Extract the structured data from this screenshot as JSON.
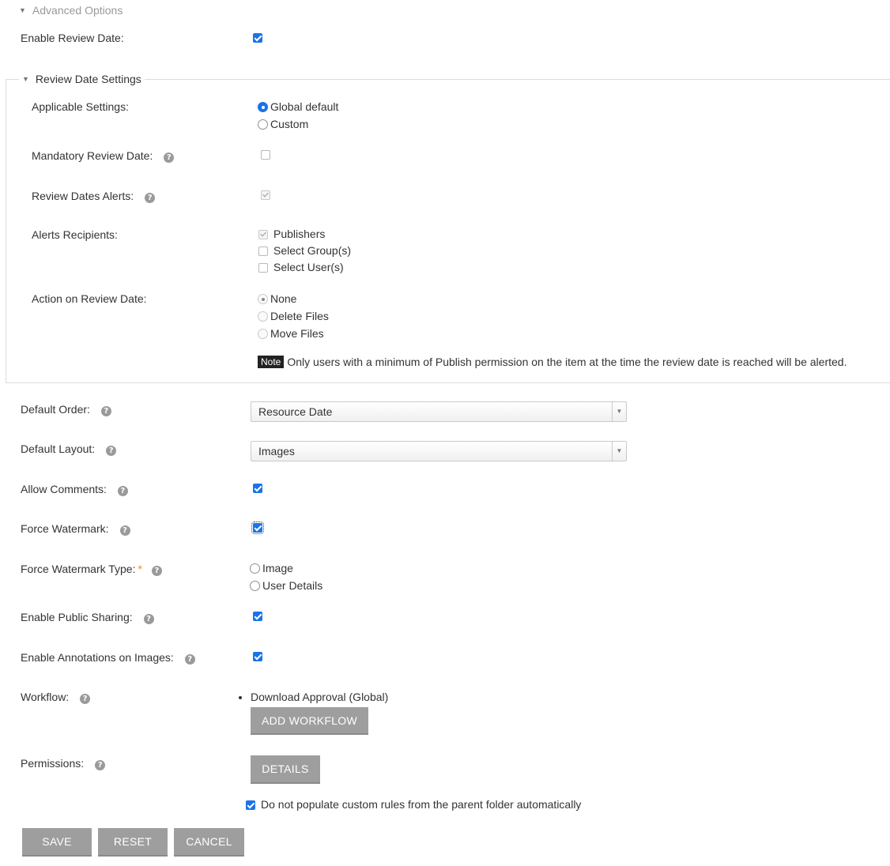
{
  "advanced_options": {
    "label": "Advanced Options"
  },
  "enable_review_date": {
    "label": "Enable Review Date:"
  },
  "review_date_settings": {
    "legend": "Review Date Settings",
    "applicable_settings": {
      "label": "Applicable Settings:",
      "options": [
        "Global default",
        "Custom"
      ],
      "selected": "Global default"
    },
    "mandatory_review_date": {
      "label": "Mandatory Review Date:"
    },
    "review_dates_alerts": {
      "label": "Review Dates Alerts:"
    },
    "alerts_recipients": {
      "label": "Alerts Recipients:",
      "options": [
        "Publishers",
        "Select Group(s)",
        "Select User(s)"
      ]
    },
    "action_on_review_date": {
      "label": "Action on Review Date:",
      "options": [
        "None",
        "Delete Files",
        "Move Files"
      ],
      "selected": "None"
    },
    "note": {
      "badge": "Note",
      "text": "Only users with a minimum of Publish permission on the item at the time the review date is reached will be alerted."
    }
  },
  "default_order": {
    "label": "Default Order:",
    "value": "Resource Date"
  },
  "default_layout": {
    "label": "Default Layout:",
    "value": "Images"
  },
  "allow_comments": {
    "label": "Allow Comments:"
  },
  "force_watermark": {
    "label": "Force Watermark:"
  },
  "force_watermark_type": {
    "label": "Force Watermark Type:",
    "required_mark": "*",
    "options": [
      "Image",
      "User Details"
    ]
  },
  "enable_public_sharing": {
    "label": "Enable Public Sharing:"
  },
  "enable_annotations": {
    "label": "Enable Annotations on Images:"
  },
  "workflow": {
    "label": "Workflow:",
    "items": [
      "Download Approval (Global)"
    ],
    "add_button": "ADD WORKFLOW"
  },
  "permissions": {
    "label": "Permissions:",
    "details_button": "DETAILS"
  },
  "no_populate": {
    "label": "Do not populate custom rules from the parent folder automatically"
  },
  "actions": {
    "save": "SAVE",
    "reset": "RESET",
    "cancel": "CANCEL"
  },
  "icons": {
    "help": "?",
    "collapse": "▼",
    "dropdown": "▼"
  },
  "colors": {
    "accent": "#1a73e8",
    "button": "#9e9e9e",
    "required": "#f08a24"
  }
}
